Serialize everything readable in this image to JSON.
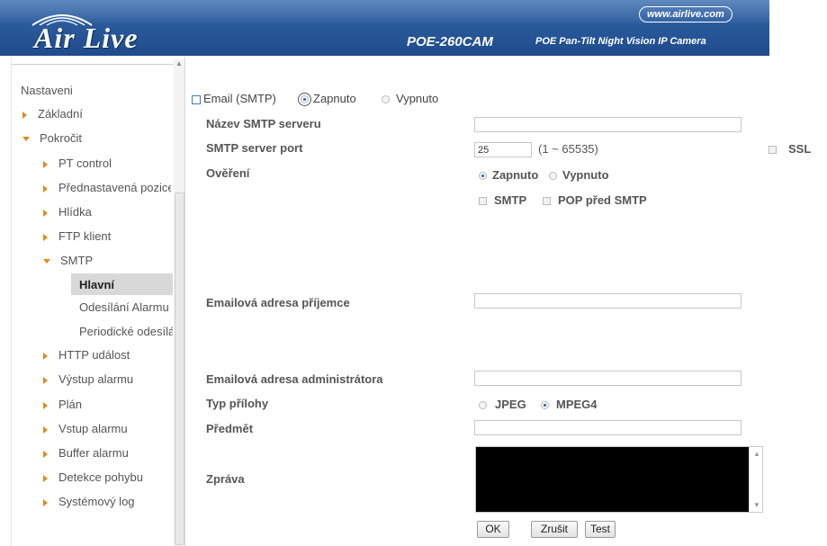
{
  "header": {
    "logo_text": "Air Live",
    "url": "www.airlive.com",
    "model": "POE-260CAM",
    "model_desc": "POE Pan-Tilt Night Vision IP Camera"
  },
  "sidebar": {
    "title": "Nastaveni",
    "items": [
      {
        "label": "Základní"
      },
      {
        "label": "Pokročit"
      },
      {
        "label": "PT control"
      },
      {
        "label": "Přednastavená pozice"
      },
      {
        "label": "Hlídka"
      },
      {
        "label": "FTP klient"
      },
      {
        "label": "SMTP"
      },
      {
        "label": "HTTP událost"
      },
      {
        "label": "Výstup alarmu"
      },
      {
        "label": "Plán"
      },
      {
        "label": "Vstup alarmu"
      },
      {
        "label": "Buffer alarmu"
      },
      {
        "label": "Detekce pohybu"
      },
      {
        "label": "Systémový log"
      }
    ],
    "smtp_sub": [
      {
        "label": "Hlavní"
      },
      {
        "label": "Odesílání Alarmu"
      },
      {
        "label": "Periodické odesílání"
      }
    ]
  },
  "form": {
    "email_label": "Email (SMTP)",
    "on": "Zapnuto",
    "off": "Vypnuto",
    "smtp_server_label": "Název SMTP serveru",
    "smtp_server_value": "",
    "port_label": "SMTP server port",
    "port_value": "25",
    "port_range": "(1 ~ 65535)",
    "ssl": "SSL",
    "auth_label": "Ověření",
    "smtp_chk": "SMTP",
    "pop_chk": "POP před SMTP",
    "recipient_label": "Emailová adresa příjemce",
    "recipient_value": "",
    "admin_label": "Emailová adresa administrátora",
    "admin_value": "",
    "attach_label": "Typ přílohy",
    "jpeg": "JPEG",
    "mpeg4": "MPEG4",
    "subject_label": "Předmět",
    "subject_value": "",
    "message_label": "Zpráva"
  },
  "buttons": {
    "ok": "OK",
    "cancel": "Zrušit",
    "test": "Test"
  },
  "colors": {
    "banner": "#2a5a9c",
    "accent_triangle": "#e08a1e",
    "radio_dot": "#2a64b0",
    "textarea_bg": "#000000"
  }
}
